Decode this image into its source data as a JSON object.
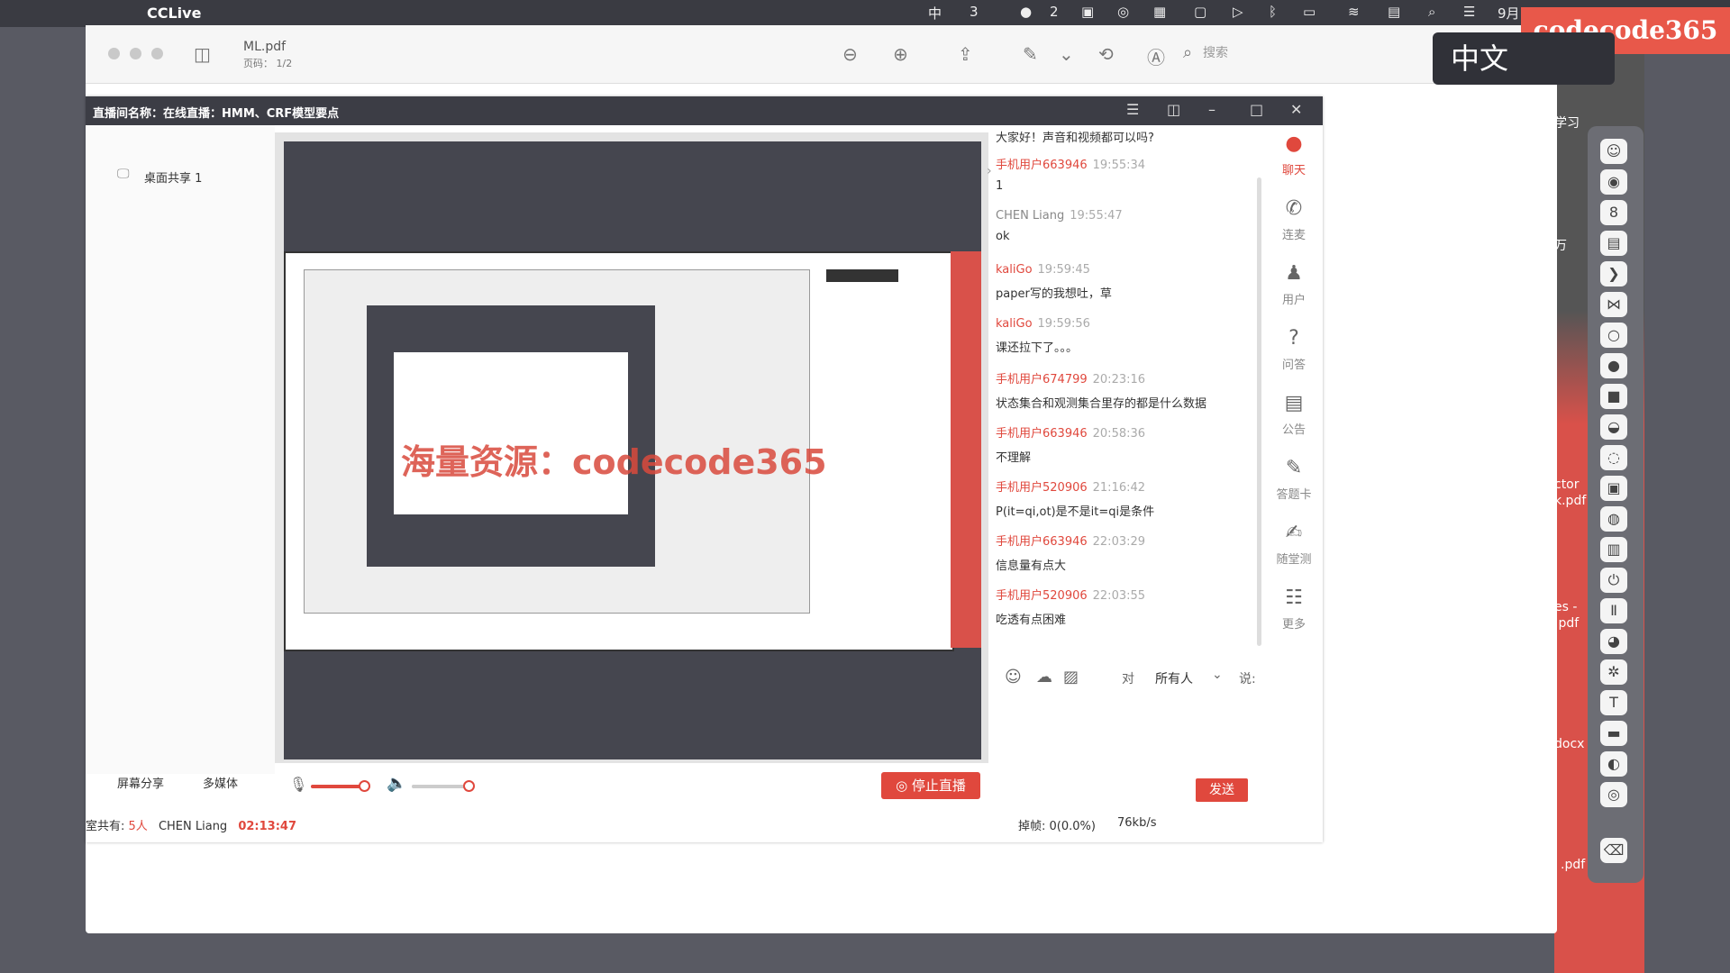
{
  "menubar": {
    "app_name": "CCLive",
    "input_method": "中",
    "badge_count": "3",
    "wechat_count": "2",
    "date_partial": "9月"
  },
  "watermark": "codecode365",
  "ime_popup": "中文",
  "pdf": {
    "file": "ML.pdf",
    "page": "页码： 1/2",
    "search_placeholder": "搜索"
  },
  "cc": {
    "title": "直播间名称：在线直播：HMM、CRF模型要点",
    "desk_share": "桌面共享 1",
    "overlay": "海量资源：codecode365"
  },
  "chat": {
    "first_text": "大家好！声音和视频都可以吗?",
    "messages": [
      {
        "name": "手机用户663946",
        "time": "19:55:34",
        "text": "1"
      },
      {
        "name": "CHEN Liang",
        "time": "19:55:47",
        "text": "ok"
      },
      {
        "name": "kaliGo",
        "time": "19:59:45",
        "text": "paper写的我想吐，草"
      },
      {
        "name": "kaliGo",
        "time": "19:59:56",
        "text": "课还拉下了。。。"
      },
      {
        "name": "手机用户674799",
        "time": "20:23:16",
        "text": "状态集合和观测集合里存的都是什么数据"
      },
      {
        "name": "手机用户663946",
        "time": "20:58:36",
        "text": "不理解"
      },
      {
        "name": "手机用户520906",
        "time": "21:16:42",
        "text": "P(it=qi,ot)是不是it=qi是条件"
      },
      {
        "name": "手机用户663946",
        "time": "22:03:29",
        "text": "信息量有点大"
      },
      {
        "name": "手机用户520906",
        "time": "22:03:55",
        "text": "吃透有点困难"
      }
    ],
    "to_label": "对",
    "recipient": "所有人",
    "say_label": "说:"
  },
  "sidebar": [
    "聊天",
    "连麦",
    "用户",
    "问答",
    "公告",
    "答题卡",
    "随堂测",
    "更多"
  ],
  "controls": {
    "screen_share": "屏幕分享",
    "multimedia": "多媒体",
    "stop_live": "停止直播",
    "send": "发送",
    "mic_level": 0.9,
    "volume_level": 0.95
  },
  "status": {
    "room_prefix": "室共有:",
    "room_count": "5人",
    "user": "CHEN Liang",
    "elapsed": "02:13:47",
    "drop_frames": "掉帧: 0(0.0%)",
    "bitrate": "76kb/s"
  },
  "desktop_files": [
    "学习",
    "万",
    "ctor",
    "k.pdf",
    "es -",
    ".pdf",
    "docx",
    ".pdf"
  ]
}
